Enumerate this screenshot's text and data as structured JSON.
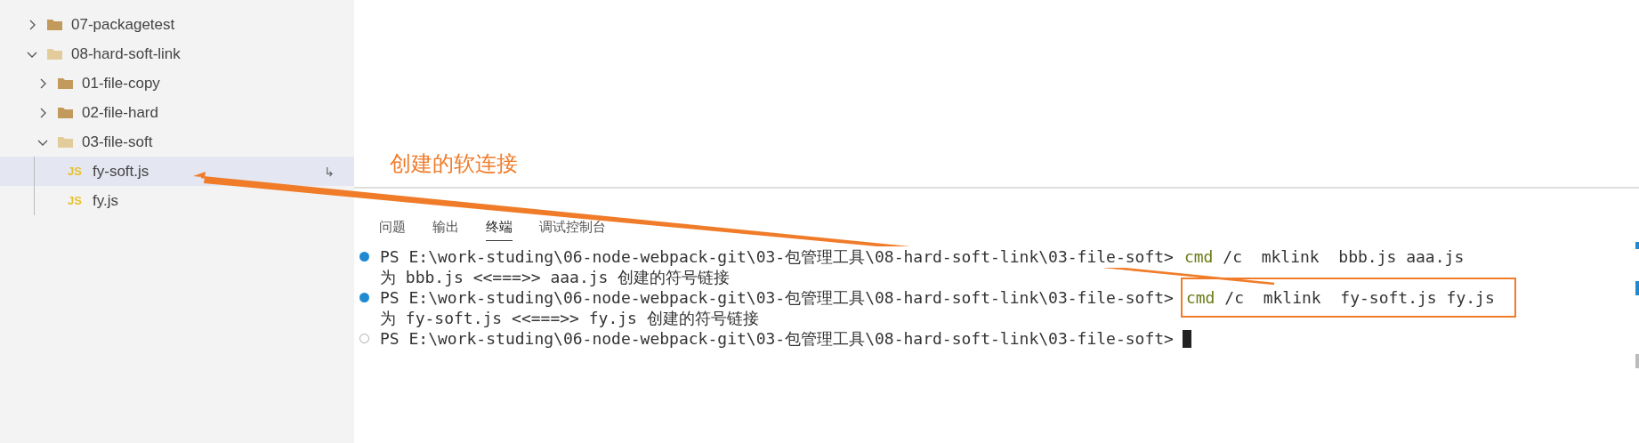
{
  "sidebar": {
    "items": [
      {
        "kind": "folder",
        "label": "07-packagetest",
        "expanded": false,
        "selected": false
      },
      {
        "kind": "folder",
        "label": "08-hard-soft-link",
        "expanded": true,
        "selected": false,
        "children": [
          {
            "kind": "folder",
            "label": "01-file-copy",
            "expanded": false,
            "selected": false
          },
          {
            "kind": "folder",
            "label": "02-file-hard",
            "expanded": false,
            "selected": false
          },
          {
            "kind": "folder",
            "label": "03-file-soft",
            "expanded": true,
            "selected": false,
            "children": [
              {
                "kind": "file",
                "icon": "JS",
                "label": "fy-soft.js",
                "selected": true,
                "badge": "↳"
              },
              {
                "kind": "file",
                "icon": "JS",
                "label": "fy.js",
                "selected": false
              }
            ]
          }
        ]
      }
    ]
  },
  "annotation": {
    "text": "创建的软连接"
  },
  "panel": {
    "tabs": [
      {
        "label": "问题",
        "selected": false
      },
      {
        "label": "输出",
        "selected": false
      },
      {
        "label": "终端",
        "selected": true
      },
      {
        "label": "调试控制台",
        "selected": false
      }
    ]
  },
  "terminal": {
    "lines": [
      {
        "kind": "prompt",
        "succeeded": true,
        "path": "PS E:\\work-studing\\06-node-webpack-git\\03-包管理工具\\08-hard-soft-link\\03-file-soft>",
        "program": "cmd",
        "args": "/c  mklink  bbb.js aaa.js",
        "highlighted": false
      },
      {
        "kind": "output",
        "text": "为 bbb.js <<===>> aaa.js 创建的符号链接"
      },
      {
        "kind": "prompt",
        "succeeded": true,
        "path": "PS E:\\work-studing\\06-node-webpack-git\\03-包管理工具\\08-hard-soft-link\\03-file-soft>",
        "program": "cmd",
        "args": "/c  mklink  fy-soft.js fy.js",
        "highlighted": true
      },
      {
        "kind": "output",
        "text": "为 fy-soft.js <<===>> fy.js 创建的符号链接"
      },
      {
        "kind": "prompt",
        "succeeded": false,
        "path": "PS E:\\work-studing\\06-node-webpack-git\\03-包管理工具\\08-hard-soft-link\\03-file-soft>",
        "cursor": true
      }
    ]
  }
}
